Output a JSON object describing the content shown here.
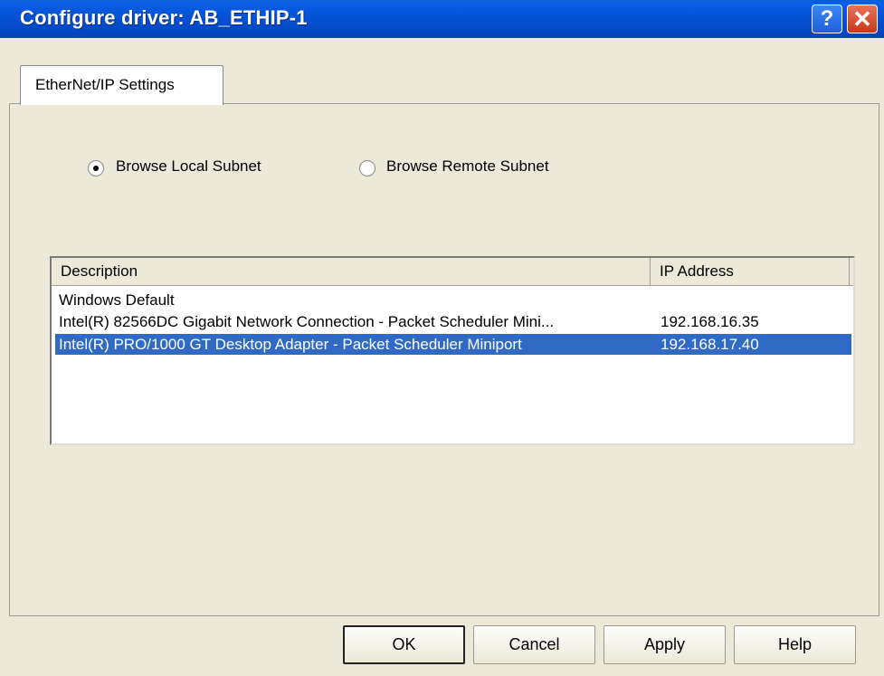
{
  "window": {
    "title": "Configure driver: AB_ETHIP-1",
    "help_glyph": "?",
    "close_glyph": "✕"
  },
  "tabs": [
    {
      "label": "EtherNet/IP Settings",
      "selected": true
    }
  ],
  "browse_options": [
    {
      "label": "Browse Local Subnet",
      "checked": true
    },
    {
      "label": "Browse Remote Subnet",
      "checked": false
    }
  ],
  "list": {
    "columns": [
      "Description",
      "IP Address"
    ],
    "rows": [
      {
        "description": "Windows Default",
        "ip": "",
        "selected": false
      },
      {
        "description": "Intel(R) 82566DC Gigabit Network Connection - Packet Scheduler Mini...",
        "ip": "192.168.16.35",
        "selected": false
      },
      {
        "description": "Intel(R) PRO/1000 GT Desktop Adapter - Packet Scheduler Miniport",
        "ip": "192.168.17.40",
        "selected": true
      }
    ],
    "selection_color": "#316ac5"
  },
  "buttons": {
    "ok": "OK",
    "cancel": "Cancel",
    "apply": "Apply",
    "help": "Help"
  }
}
